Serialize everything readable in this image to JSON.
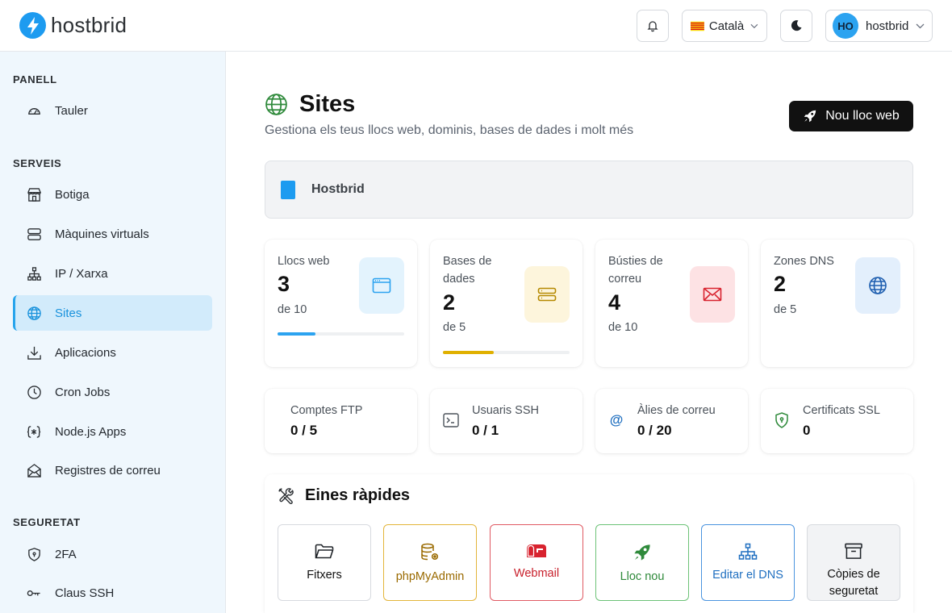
{
  "brand": {
    "name": "hostbrid"
  },
  "header": {
    "language": "Català",
    "user": {
      "initials": "HO",
      "name": "hostbrid"
    }
  },
  "sidebar": {
    "sections": [
      {
        "title": "PANELL",
        "items": [
          {
            "label": "Tauler",
            "icon": "dashboard-gauge-icon"
          }
        ]
      },
      {
        "title": "SERVEIS",
        "items": [
          {
            "label": "Botiga",
            "icon": "store-icon"
          },
          {
            "label": "Màquines virtuals",
            "icon": "server-icon"
          },
          {
            "label": "IP / Xarxa",
            "icon": "network-icon"
          },
          {
            "label": "Sites",
            "icon": "globe-icon",
            "active": true
          },
          {
            "label": "Aplicacions",
            "icon": "download-icon"
          },
          {
            "label": "Cron Jobs",
            "icon": "clock-icon"
          },
          {
            "label": "Node.js Apps",
            "icon": "code-braces-icon"
          },
          {
            "label": "Registres de correu",
            "icon": "mail-open-icon"
          }
        ]
      },
      {
        "title": "SEGURETAT",
        "items": [
          {
            "label": "2FA",
            "icon": "shield-icon"
          },
          {
            "label": "Claus SSH",
            "icon": "key-icon"
          }
        ]
      }
    ]
  },
  "page": {
    "title": "Sites",
    "subtitle": "Gestiona els teus llocs web, dominis, bases de dades i molt més",
    "new_button": "Nou lloc web",
    "org_name": "Hostbrid"
  },
  "stats": [
    {
      "label": "Llocs web",
      "value": "3",
      "sub": "de 10",
      "usage": 0.3,
      "color": "#2ca3f0",
      "icon_bg": "#e3f3fd"
    },
    {
      "label": "Bases de dades",
      "value": "2",
      "sub": "de 5",
      "usage": 0.4,
      "color": "#e0b000",
      "icon_bg": "#fdf5dc"
    },
    {
      "label": "Bústies de correu",
      "value": "4",
      "sub": "de 10",
      "color": "#d8232f",
      "icon_bg": "#fde2e4"
    },
    {
      "label": "Zones DNS",
      "value": "2",
      "sub": "de 5",
      "color": "#1f5fb0",
      "icon_bg": "#e3effc"
    }
  ],
  "mini_stats": [
    {
      "label": "Comptes FTP",
      "value": "0 / 5"
    },
    {
      "label": "Usuaris SSH",
      "value": "0 / 1",
      "icon": "terminal-icon"
    },
    {
      "label": "Àlies de correu",
      "value": "0 / 20",
      "icon": "at-sign-icon"
    },
    {
      "label": "Certificats SSL",
      "value": "0",
      "icon": "shield-lock-icon"
    }
  ],
  "tools": {
    "title": "Eines ràpides",
    "items": [
      {
        "label": "Fitxers",
        "color": "#111111",
        "border": "#d7dadf",
        "bg": "#ffffff"
      },
      {
        "label": "phpMyAdmin",
        "color": "#9a6a00",
        "border": "#e3b53a",
        "bg": "#ffffff"
      },
      {
        "label": "Webmail",
        "color": "#c81e2a",
        "border": "#e05a63",
        "bg": "#ffffff"
      },
      {
        "label": "Lloc nou",
        "color": "#2f8a3b",
        "border": "#6cc277",
        "bg": "#ffffff"
      },
      {
        "label": "Editar el DNS",
        "color": "#1f6fc0",
        "border": "#4a94df",
        "bg": "#ffffff"
      },
      {
        "label": "Còpies de seguretat",
        "color": "#111111",
        "border": "#d7dadf",
        "bg": "#f2f3f5"
      }
    ]
  }
}
